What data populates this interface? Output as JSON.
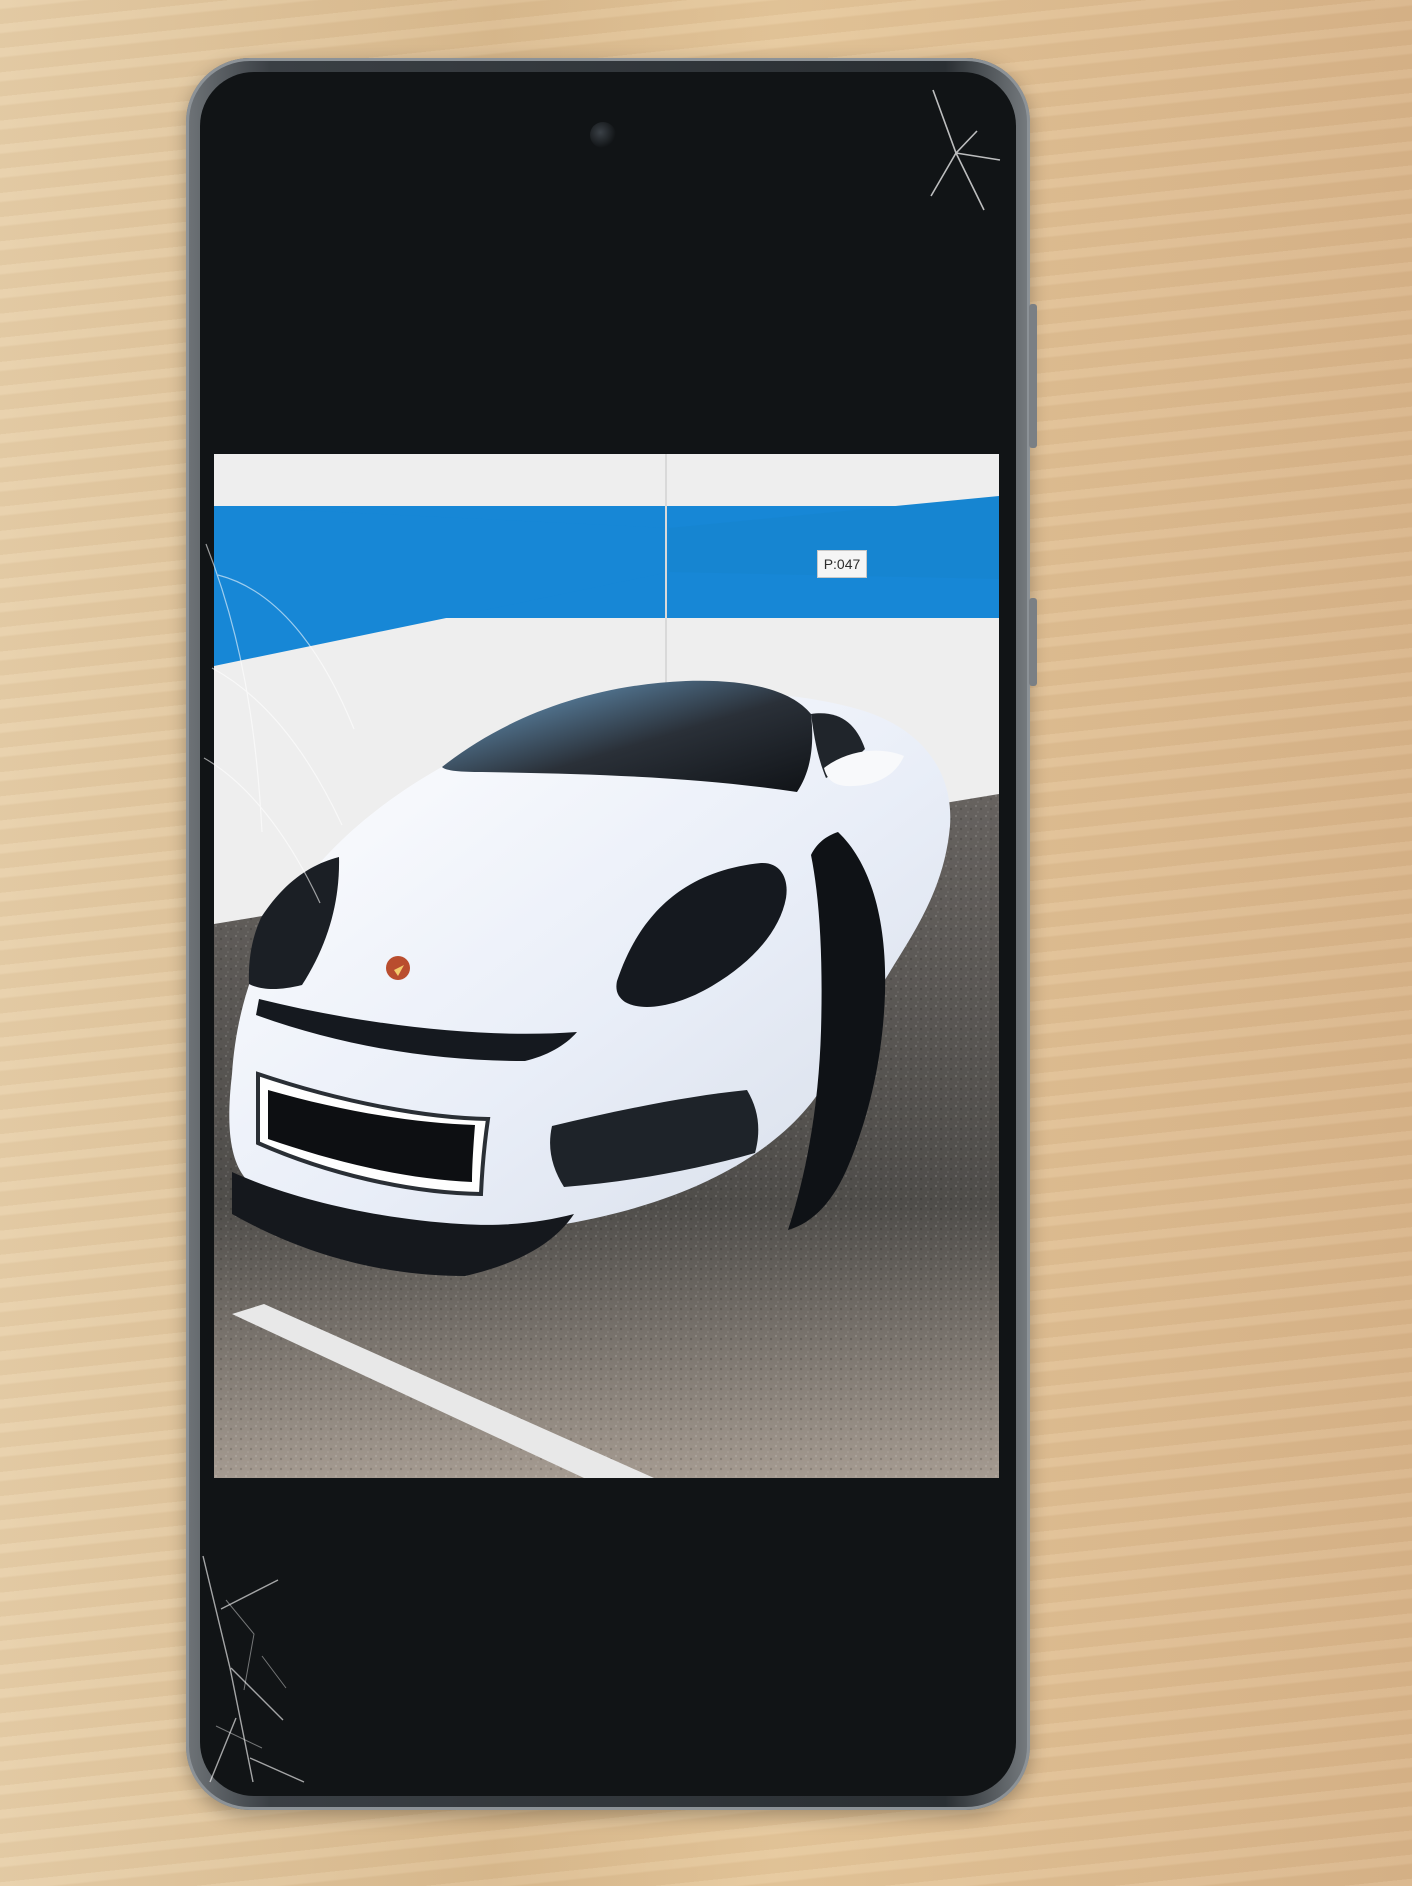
{
  "scene": {
    "background": "wooden-table",
    "device": "smartphone",
    "screen_content": "car-photo"
  },
  "photo": {
    "sign_text": "P:047"
  },
  "colors": {
    "table": "#d8b98e",
    "phone_frame": "#3a3f44",
    "screen_black": "#111416",
    "wall_blue": "#1787d6",
    "car_white": "#f1f4fa",
    "headlight_dark": "#15191f",
    "parking_line": "#e8e8e8"
  },
  "icons": {
    "camera": "front-camera-icon",
    "logo": "car-logo-icon"
  }
}
